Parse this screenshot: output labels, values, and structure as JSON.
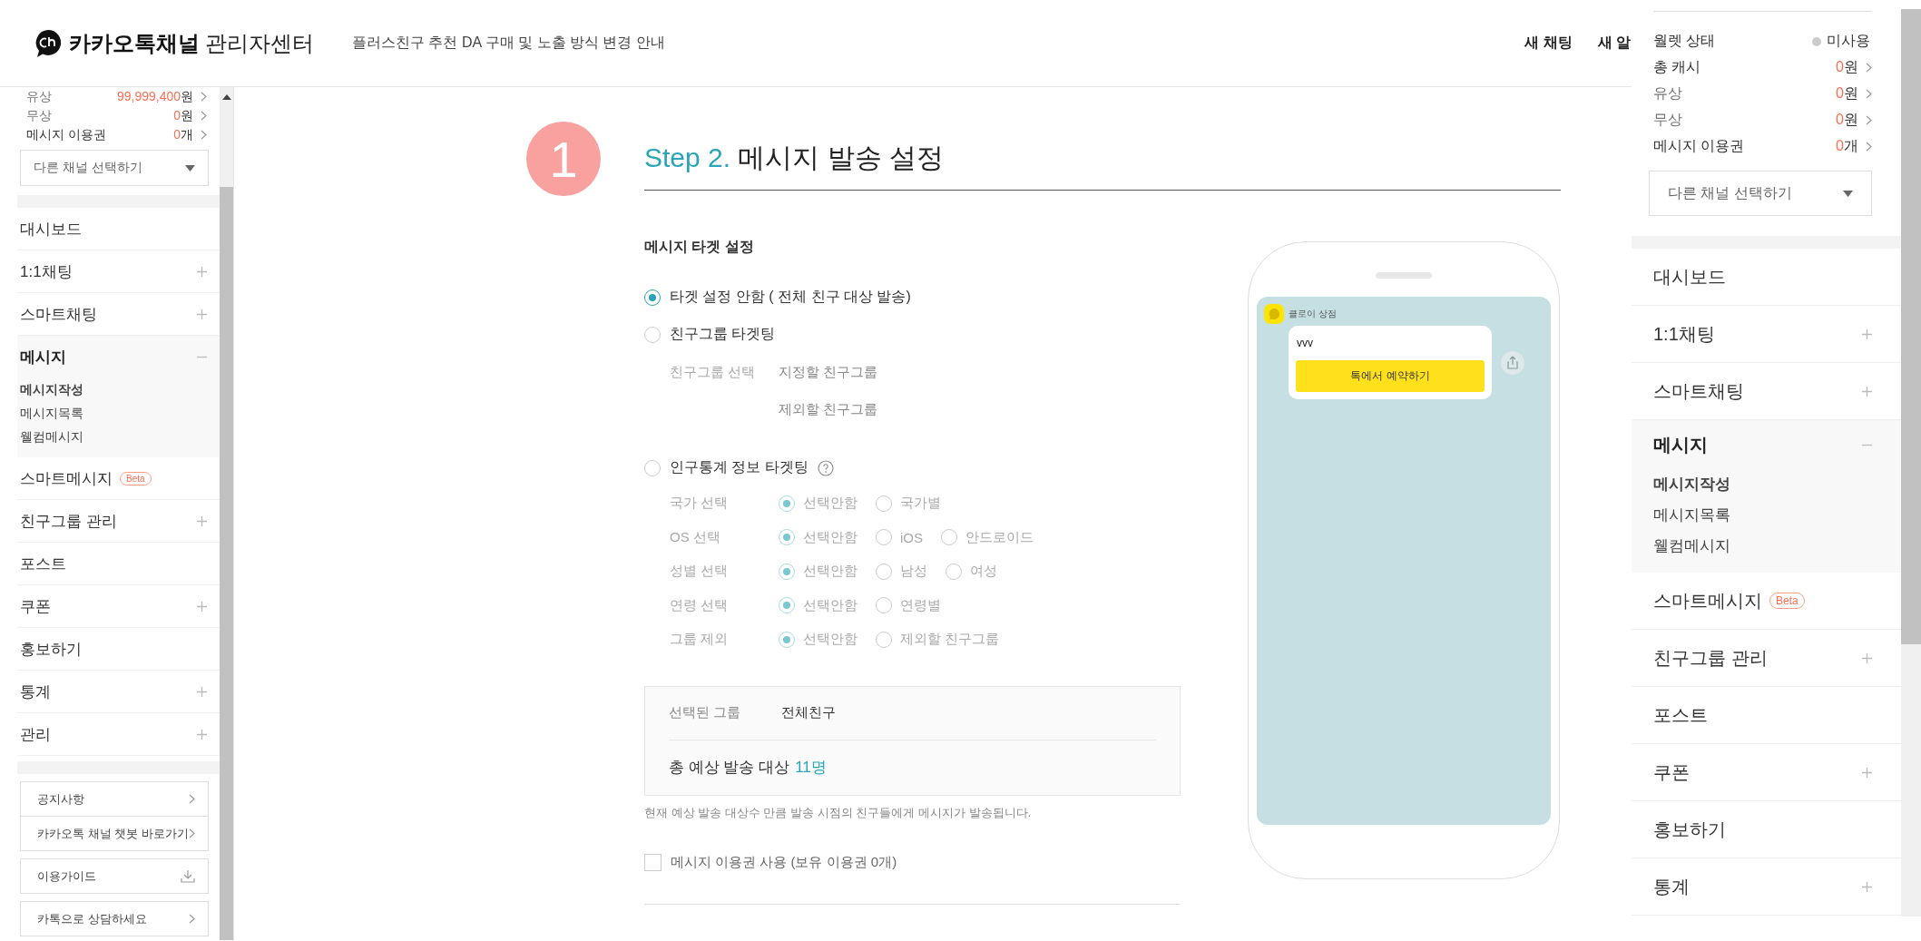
{
  "header": {
    "logo_bold": "카카오톡채널",
    "logo_light": "관리자센터",
    "notice": "플러스친구 추천 DA 구매 및 노출 방식 변경 안내",
    "actions": [
      "새 채팅",
      "새 알"
    ]
  },
  "sidebar": {
    "balances": [
      {
        "label": "유상",
        "amount": "99,999,400",
        "unit": "원",
        "muted": true
      },
      {
        "label": "무상",
        "amount": "0",
        "unit": "원",
        "muted": true
      },
      {
        "label": "메시지 이용권",
        "amount": "0",
        "unit": "개",
        "muted": false
      }
    ],
    "channel_select": "다른 채널 선택하기",
    "nav": [
      {
        "label": "대시보드"
      },
      {
        "label": "1:1채팅",
        "expanded": false
      },
      {
        "label": "스마트채팅",
        "expanded": false
      },
      {
        "label": "메시지",
        "expanded": true,
        "children": [
          {
            "label": "메시지작성",
            "selected": true
          },
          {
            "label": "메시지목록",
            "selected": false
          },
          {
            "label": "웰컴메시지",
            "selected": false
          }
        ]
      },
      {
        "label": "스마트메시지",
        "badge": "Beta"
      },
      {
        "label": "친구그룹 관리",
        "expanded": false
      },
      {
        "label": "포스트"
      },
      {
        "label": "쿠폰",
        "expanded": false
      },
      {
        "label": "홍보하기"
      },
      {
        "label": "통계",
        "expanded": false
      },
      {
        "label": "관리",
        "expanded": false
      }
    ],
    "link_groups": [
      {
        "links": [
          {
            "label": "공지사항",
            "kind": "link"
          },
          {
            "label": "카카오톡 채널 챗봇 바로가기",
            "kind": "link"
          }
        ]
      },
      {
        "links": [
          {
            "label": "이용가이드",
            "kind": "download"
          }
        ]
      },
      {
        "links": [
          {
            "label": "카톡으로 상담하세요",
            "kind": "link"
          }
        ]
      }
    ]
  },
  "step": {
    "number": "1",
    "prefix": "Step 2.",
    "title": "메시지 발송 설정"
  },
  "target": {
    "heading": "메시지 타겟 설정",
    "options": [
      {
        "kind": "plain",
        "label": "타겟 설정 안함 ( 전체 친구 대상 발송)",
        "selected": true
      },
      {
        "kind": "group",
        "label": "친구그룹 타겟팅",
        "selected": false,
        "field_label": "친구그룹 선택",
        "values": [
          "지정할 친구그룹",
          "제외할 친구그룹"
        ]
      },
      {
        "kind": "demographic",
        "label": "인구통계 정보 타겟팅",
        "selected": false,
        "rows": [
          {
            "label": "국가 선택",
            "choices": [
              {
                "label": "선택안함",
                "selected": true
              },
              {
                "label": "국가별",
                "selected": false
              }
            ]
          },
          {
            "label": "OS 선택",
            "choices": [
              {
                "label": "선택안함",
                "selected": true
              },
              {
                "label": "iOS",
                "selected": false
              },
              {
                "label": "안드로이드",
                "selected": false
              }
            ]
          },
          {
            "label": "성별 선택",
            "choices": [
              {
                "label": "선택안함",
                "selected": true
              },
              {
                "label": "남성",
                "selected": false
              },
              {
                "label": "여성",
                "selected": false
              }
            ]
          },
          {
            "label": "연령 선택",
            "choices": [
              {
                "label": "선택안함",
                "selected": true
              },
              {
                "label": "연령별",
                "selected": false
              }
            ]
          },
          {
            "label": "그룹 제외",
            "choices": [
              {
                "label": "선택안함",
                "selected": true
              },
              {
                "label": "제외할 친구그룹",
                "selected": false
              }
            ]
          }
        ]
      }
    ]
  },
  "summary": {
    "group_label": "선택된 그룹",
    "group_value": "전체친구",
    "total_label": "총 예상 발송 대상",
    "total_count": "11명"
  },
  "note": "현재 예상 발송 대상수 만큼 발송 시점의 친구들에게 메시지가 발송됩니다.",
  "voucher": {
    "label": "메시지 이용권 사용 (보유 이용권 0개)",
    "checked": false
  },
  "preview": {
    "sender": "클로이 상점",
    "message": "vvv",
    "button": "톡에서 예약하기"
  },
  "overlay": {
    "wallet_label": "월렛 상태",
    "wallet_value": "미사용",
    "balances": [
      {
        "label": "총 캐시",
        "amount": "0",
        "unit": "원",
        "muted": false
      },
      {
        "label": "유상",
        "amount": "0",
        "unit": "원",
        "muted": true
      },
      {
        "label": "무상",
        "amount": "0",
        "unit": "원",
        "muted": true
      },
      {
        "label": "메시지 이용권",
        "amount": "0",
        "unit": "개",
        "muted": false
      }
    ],
    "channel_select": "다른 채널 선택하기",
    "nav": [
      {
        "label": "대시보드"
      },
      {
        "label": "1:1채팅",
        "expanded": false
      },
      {
        "label": "스마트채팅",
        "expanded": false
      },
      {
        "label": "메시지",
        "expanded": true,
        "children": [
          {
            "label": "메시지작성",
            "selected": true
          },
          {
            "label": "메시지목록",
            "selected": false
          },
          {
            "label": "웰컴메시지",
            "selected": false
          }
        ]
      },
      {
        "label": "스마트메시지",
        "badge": "Beta"
      },
      {
        "label": "친구그룹 관리",
        "expanded": false
      },
      {
        "label": "포스트"
      },
      {
        "label": "쿠폰",
        "expanded": false
      },
      {
        "label": "홍보하기"
      },
      {
        "label": "통계",
        "expanded": false
      }
    ]
  }
}
